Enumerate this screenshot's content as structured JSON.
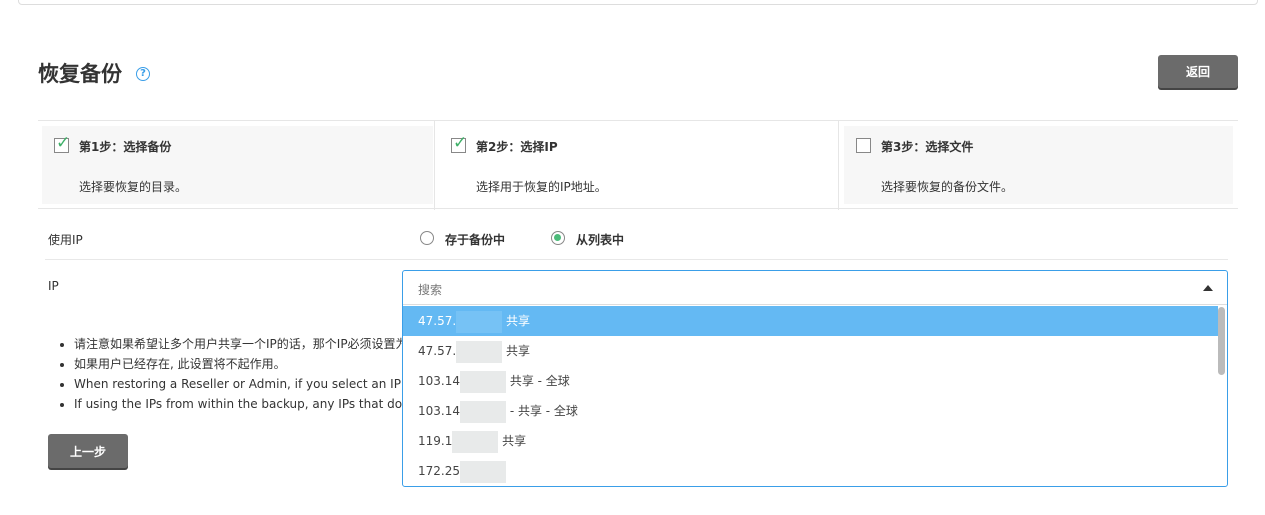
{
  "page": {
    "title": "恢复备份",
    "back_label": "返回",
    "prev_label": "上一步"
  },
  "steps": [
    {
      "title": "第1步：选择备份",
      "desc": "选择要恢复的目录。",
      "checked": true
    },
    {
      "title": "第2步：选择IP",
      "desc": "选择用于恢复的IP地址。",
      "checked": true
    },
    {
      "title": "第3步：选择文件",
      "desc": "选择要恢复的备份文件。",
      "checked": false
    }
  ],
  "use_ip": {
    "label": "使用IP",
    "options": [
      "存于备份中",
      "从列表中"
    ],
    "selected": "从列表中"
  },
  "ip": {
    "label": "IP",
    "search_placeholder": "搜索",
    "options": [
      {
        "prefix": "47.57.",
        "suffix": " 共享"
      },
      {
        "prefix": "47.57.",
        "suffix": " 共享"
      },
      {
        "prefix": "103.14",
        "suffix": " 共享 - 全球"
      },
      {
        "prefix": "103.14",
        "suffix": " - 共享 - 全球"
      },
      {
        "prefix": "119.1",
        "suffix": " 共享"
      },
      {
        "prefix": "172.25",
        "suffix": ""
      }
    ]
  },
  "notes": [
    "请注意如果希望让多个用户共享一个IP的话，那个IP必须设置为",
    "如果用户已经存在, 此设置将不起作用。",
    "When restoring a Reseller or Admin, if you select an IP from",
    "If using the IPs from within the backup, any IPs that don't e"
  ]
}
